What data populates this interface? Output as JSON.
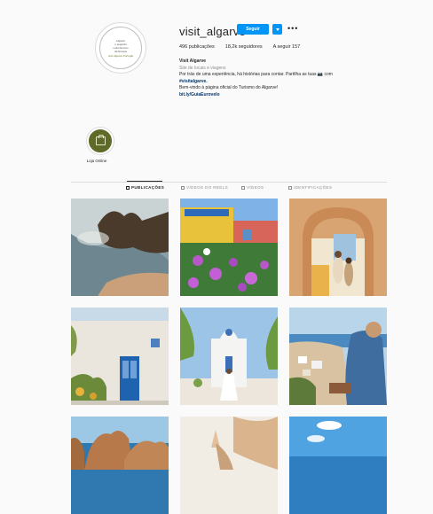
{
  "profile": {
    "username": "visit_algarve",
    "follow_label": "Seguir",
    "more_label": "•••",
    "avatar_text_lines": [
      "Algarve",
      "o segredo",
      "mais famoso",
      "da Europa"
    ],
    "avatar_brand": "visit Algarve Portugal",
    "stats": {
      "posts": "496 publicações",
      "followers": "18,2k seguidores",
      "following": "A seguir 157"
    },
    "bio": {
      "name": "Visit Algarve",
      "category": "Site de locais e viagens",
      "line1": "Por trás de uma experiência, há histórias para contar. Partilha as tuas 📷 com",
      "hashtag": "#visitalgarve.",
      "line2": "Bem-vindo à página oficial do Turismo do Algarve!",
      "link": "bit.ly/GuiaEurovelo"
    }
  },
  "highlights": [
    {
      "label": "Loja Online",
      "icon": "shopping-bag-icon"
    }
  ],
  "tabs": [
    {
      "label": "PUBLICAÇÕES",
      "active": true
    },
    {
      "label": "VÍDEOS DO REELS",
      "active": false
    },
    {
      "label": "VÍDEOS",
      "active": false
    },
    {
      "label": "IDENTIFICAÇÕES",
      "active": false
    }
  ],
  "colors": {
    "accent": "#0095f6",
    "highlight": "#5e6a27",
    "text": "#262626",
    "muted": "#8e8e8e",
    "link": "#00376b"
  },
  "posts": [
    {
      "subject": "coastal rocks and beach"
    },
    {
      "subject": "purple flowers and colorful houses"
    },
    {
      "subject": "arch and couple walking"
    },
    {
      "subject": "white wall with blue door"
    },
    {
      "subject": "white chapel with woman in dress"
    },
    {
      "subject": "man overlooking coastline town"
    },
    {
      "subject": "rock formations at sea"
    },
    {
      "subject": "person with raised arms and cliffs"
    },
    {
      "subject": "blue sky over sea"
    }
  ]
}
